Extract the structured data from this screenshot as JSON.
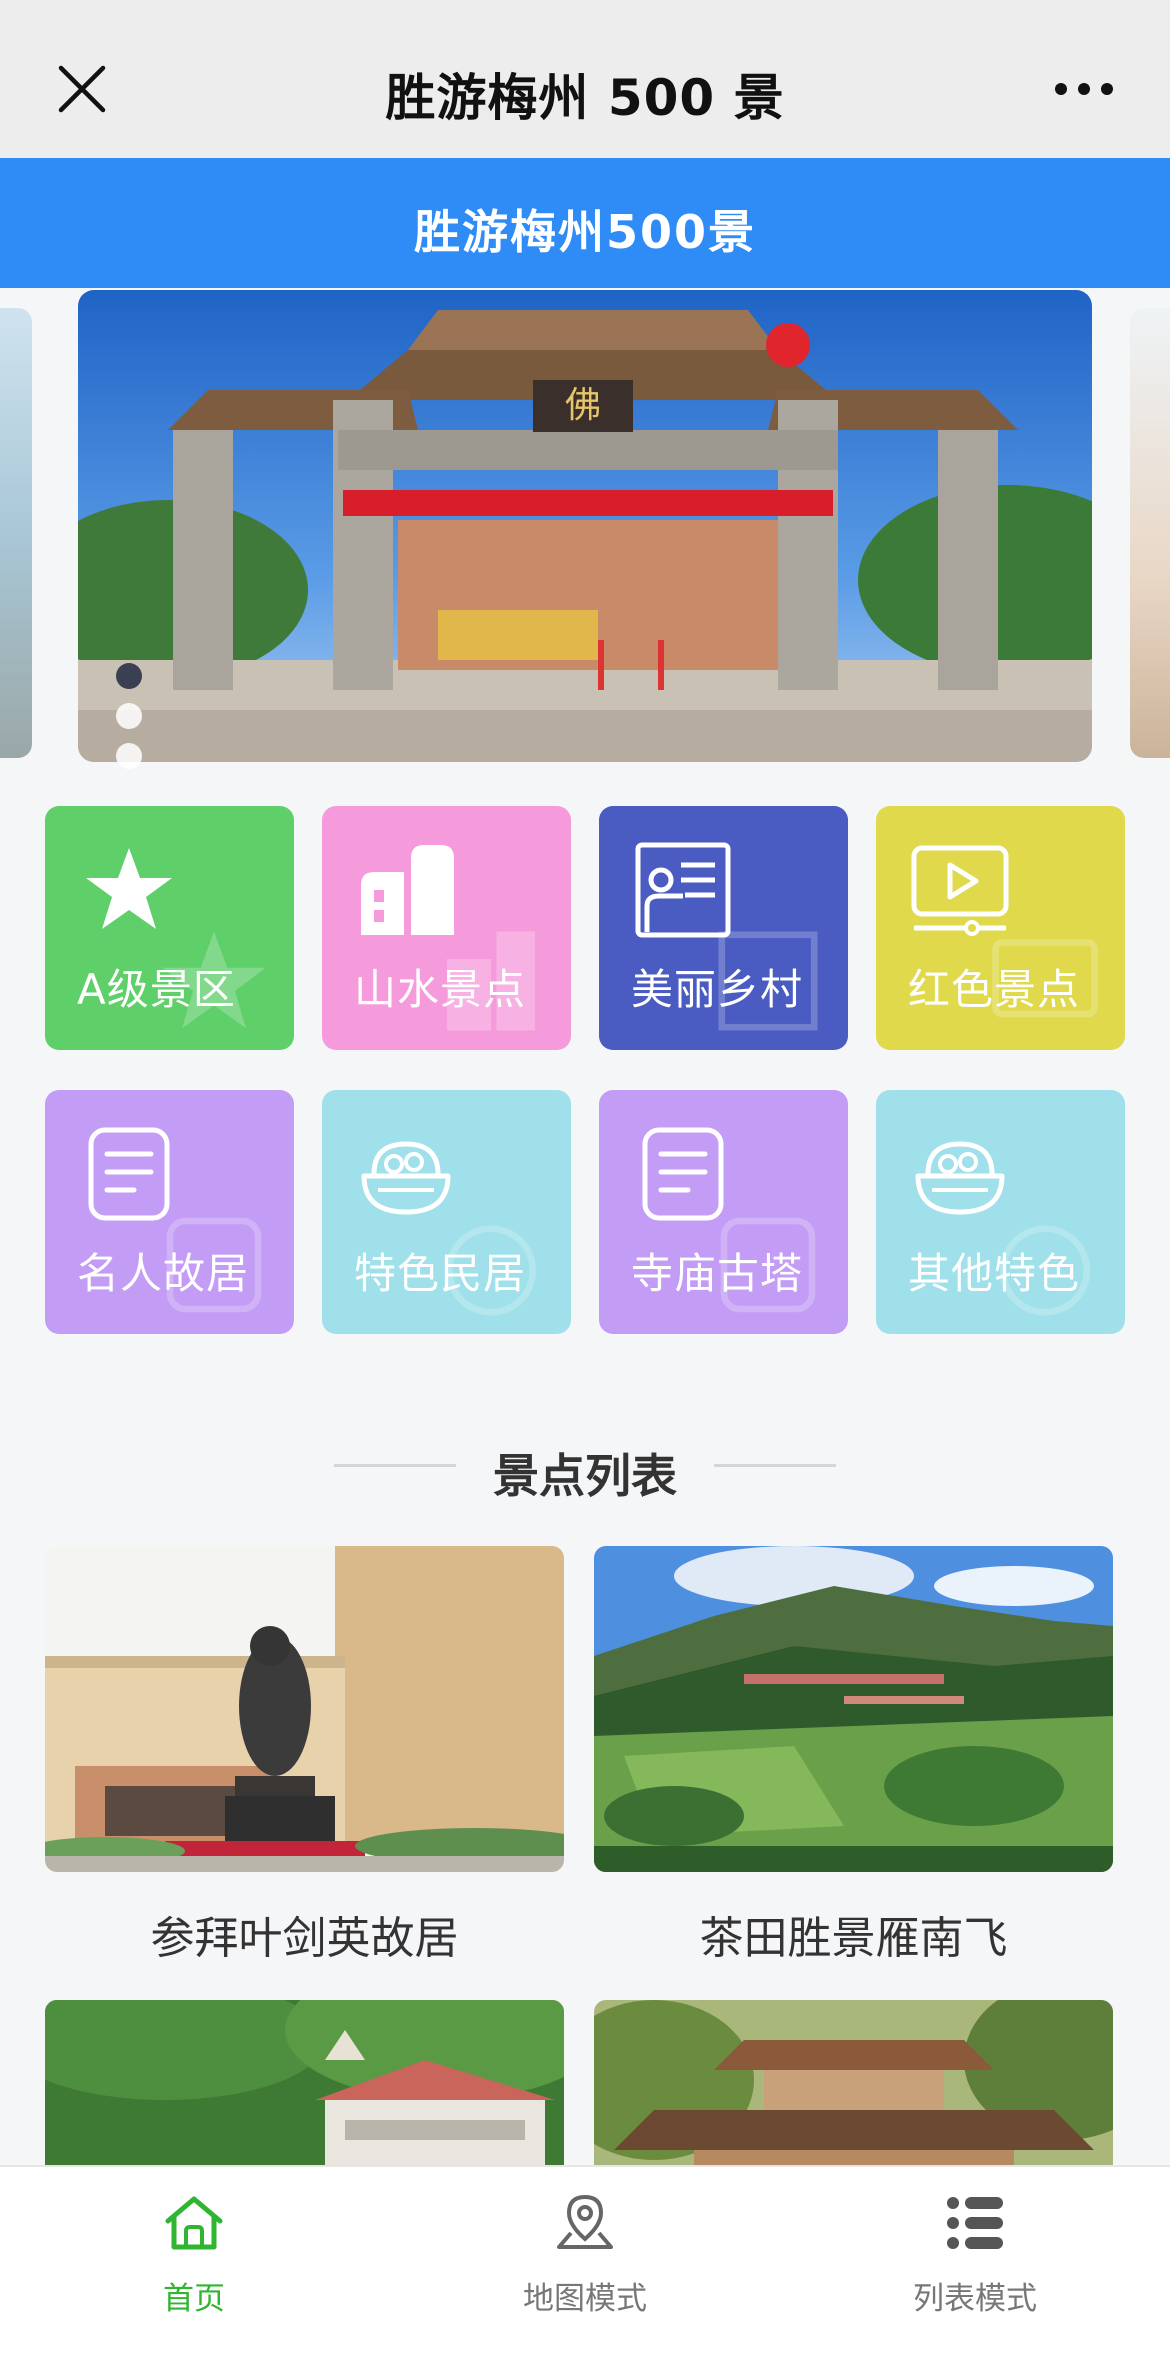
{
  "window": {
    "title": "胜游梅州 500 景"
  },
  "header": {
    "title": "胜游梅州500景"
  },
  "carousel": {
    "slide_count": 3,
    "active_index": 0
  },
  "categories": [
    {
      "label": "A级景区",
      "color": "#5fcf6a",
      "icon": "star-icon"
    },
    {
      "label": "山水景点",
      "color": "#f59bdc",
      "icon": "building-icon"
    },
    {
      "label": "美丽乡村",
      "color": "#4a5bc1",
      "icon": "teacher-board-icon"
    },
    {
      "label": "红色景点",
      "color": "#dfd94b",
      "icon": "video-play-icon"
    },
    {
      "label": "名人故居",
      "color": "#c39cf5",
      "icon": "document-icon"
    },
    {
      "label": "特色民居",
      "color": "#9fe0ea",
      "icon": "food-bowl-icon"
    },
    {
      "label": "寺庙古塔",
      "color": "#c39cf5",
      "icon": "document-icon"
    },
    {
      "label": "其他特色",
      "color": "#9fe0ea",
      "icon": "food-bowl-icon"
    }
  ],
  "list_section": {
    "title": "景点列表",
    "items": [
      {
        "caption": "参拜叶剑英故居"
      },
      {
        "caption": "茶田胜景雁南飞"
      },
      {
        "caption": ""
      },
      {
        "caption": ""
      }
    ]
  },
  "bottom_nav": {
    "items": [
      {
        "label": "首页",
        "icon": "home-icon",
        "active": true
      },
      {
        "label": "地图模式",
        "icon": "map-pin-icon",
        "active": false
      },
      {
        "label": "列表模式",
        "icon": "list-icon",
        "active": false
      }
    ],
    "active_color": "#2fb52f"
  }
}
